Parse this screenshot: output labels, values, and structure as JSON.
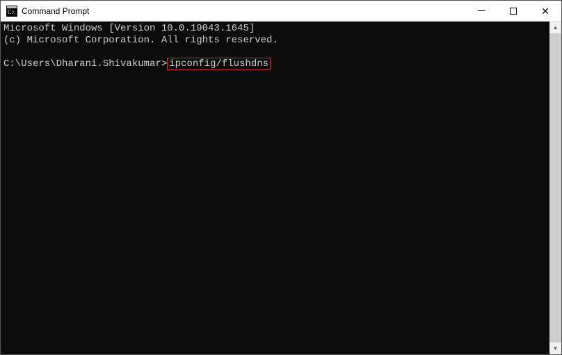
{
  "titlebar": {
    "title": "Command Prompt"
  },
  "terminal": {
    "line1": "Microsoft Windows [Version 10.0.19043.1645]",
    "line2": "(c) Microsoft Corporation. All rights reserved.",
    "blank": "",
    "prompt": "C:\\Users\\Dharani.Shivakumar>",
    "command": "ipconfig/flushdns"
  },
  "highlight_color": "#c0392b"
}
